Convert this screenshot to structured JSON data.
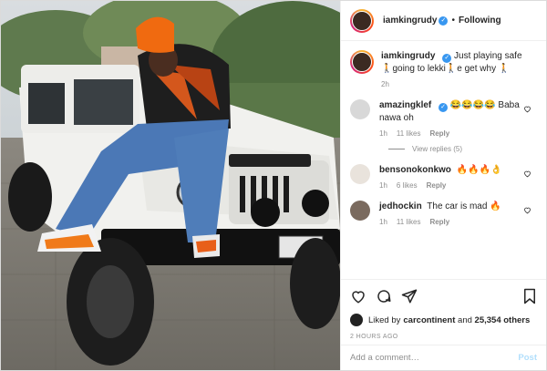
{
  "header": {
    "username": "iamkingrudy",
    "verified_glyph": "✓",
    "separator": "•",
    "follow_status": "Following"
  },
  "caption": {
    "username": "iamkingrudy",
    "text": "Just playing safe 🚶going to lekki🚶e get why 🚶",
    "time": "2h"
  },
  "comments": [
    {
      "username": "amazingklef",
      "text": "😂😂😂😂 Baba nawa oh",
      "time": "1h",
      "likes": "11 likes",
      "reply": "Reply"
    },
    {
      "username": "bensonokonkwo",
      "text": "🔥🔥🔥👌",
      "time": "1h",
      "likes": "6 likes",
      "reply": "Reply"
    },
    {
      "username": "jedhockin",
      "text": "The car is mad 🔥",
      "time": "1h",
      "likes": "11 likes",
      "reply": "Reply"
    }
  ],
  "view_replies": "View replies (5)",
  "likes": {
    "prefix": "Liked by ",
    "user": "carcontinent",
    "middle": " and ",
    "count": "25,354 others"
  },
  "posted": "2 HOURS AGO",
  "comment_box": {
    "placeholder": "Add a comment…",
    "post_label": "Post"
  },
  "icons": [
    "heart-icon",
    "comment-icon",
    "share-icon",
    "bookmark-icon",
    "more-icon"
  ],
  "colors": {
    "verified": "#3897f0",
    "post_disabled": "#b2dffc",
    "muted": "#8e8e8e",
    "fire": "#ff7a00"
  }
}
